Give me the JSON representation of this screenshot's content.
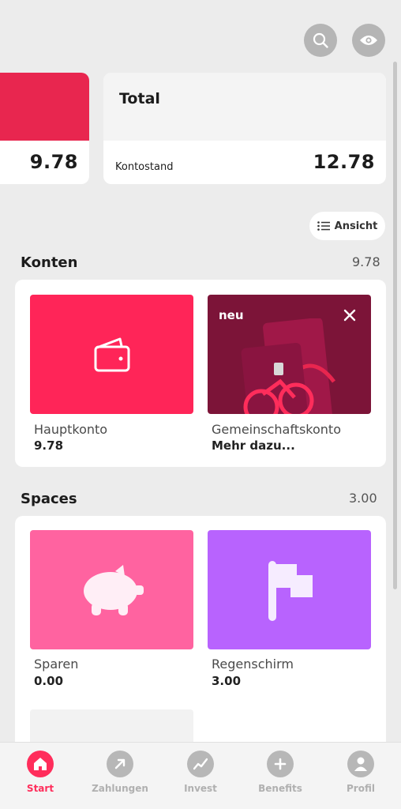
{
  "colors": {
    "accent": "#ff2d5b",
    "hauptkonto_tile": "#ff2558",
    "promo_tile": "#7c1438",
    "sparen_tile": "#ff63a0",
    "regenschirm_tile": "#b863fe"
  },
  "header": {
    "search_icon": "search-icon",
    "visibility_icon": "eye-icon"
  },
  "summary": {
    "left_card_amount": "9.78",
    "total_title": "Total",
    "kontostand_label": "Kontostand",
    "total_amount": "12.78"
  },
  "view_button": {
    "label": "Ansicht"
  },
  "konten": {
    "title": "Konten",
    "amount": "9.78",
    "tiles": [
      {
        "label": "Hauptkonto",
        "value": "9.78",
        "icon": "wallet-icon"
      },
      {
        "label": "Gemeinschaftskonto",
        "value": "Mehr dazu...",
        "badge": "neu"
      }
    ]
  },
  "spaces": {
    "title": "Spaces",
    "amount": "3.00",
    "tiles": [
      {
        "label": "Sparen",
        "value": "0.00",
        "icon": "piggy-bank-icon"
      },
      {
        "label": "Regenschirm",
        "value": "3.00",
        "icon": "flag-icon"
      }
    ]
  },
  "nav": {
    "items": [
      {
        "label": "Start",
        "icon": "home-icon",
        "active": true
      },
      {
        "label": "Zahlungen",
        "icon": "arrow-up-right-icon"
      },
      {
        "label": "Invest",
        "icon": "chart-icon"
      },
      {
        "label": "Benefits",
        "icon": "plus-icon"
      },
      {
        "label": "Profil",
        "icon": "person-icon"
      }
    ]
  }
}
